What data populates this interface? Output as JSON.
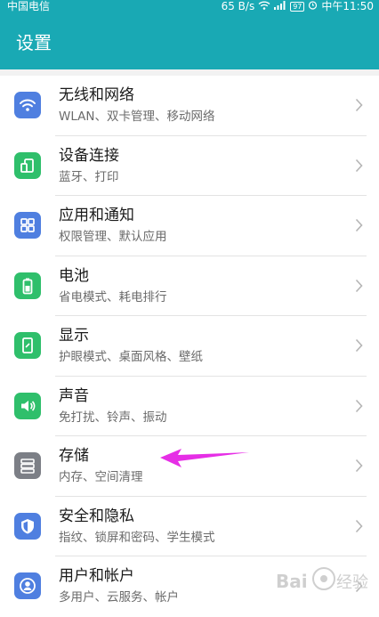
{
  "status_bar": {
    "carrier": "中国电信",
    "speed": "65 B/s",
    "battery": "97",
    "time": "中午11:50"
  },
  "header": {
    "title": "设置"
  },
  "items": [
    {
      "title": "无线和网络",
      "subtitle": "WLAN、双卡管理、移动网络",
      "icon": "wifi-icon",
      "color": "#4f7fe0"
    },
    {
      "title": "设备连接",
      "subtitle": "蓝牙、打印",
      "icon": "device-connect-icon",
      "color": "#2fbf6b"
    },
    {
      "title": "应用和通知",
      "subtitle": "权限管理、默认应用",
      "icon": "apps-icon",
      "color": "#4f7fe0"
    },
    {
      "title": "电池",
      "subtitle": "省电模式、耗电排行",
      "icon": "battery-icon",
      "color": "#2fbf6b"
    },
    {
      "title": "显示",
      "subtitle": "护眼模式、桌面风格、壁纸",
      "icon": "display-icon",
      "color": "#2fbf6b"
    },
    {
      "title": "声音",
      "subtitle": "免打扰、铃声、振动",
      "icon": "sound-icon",
      "color": "#2fbf6b"
    },
    {
      "title": "存储",
      "subtitle": "内存、空间清理",
      "icon": "storage-icon",
      "color": "#7c7f86"
    },
    {
      "title": "安全和隐私",
      "subtitle": "指纹、锁屏和密码、学生模式",
      "icon": "shield-icon",
      "color": "#4f7fe0"
    },
    {
      "title": "用户和帐户",
      "subtitle": "多用户、云服务、帐户",
      "icon": "user-icon",
      "color": "#4f7fe0"
    }
  ],
  "watermark": {
    "text": "Bai 经验"
  }
}
